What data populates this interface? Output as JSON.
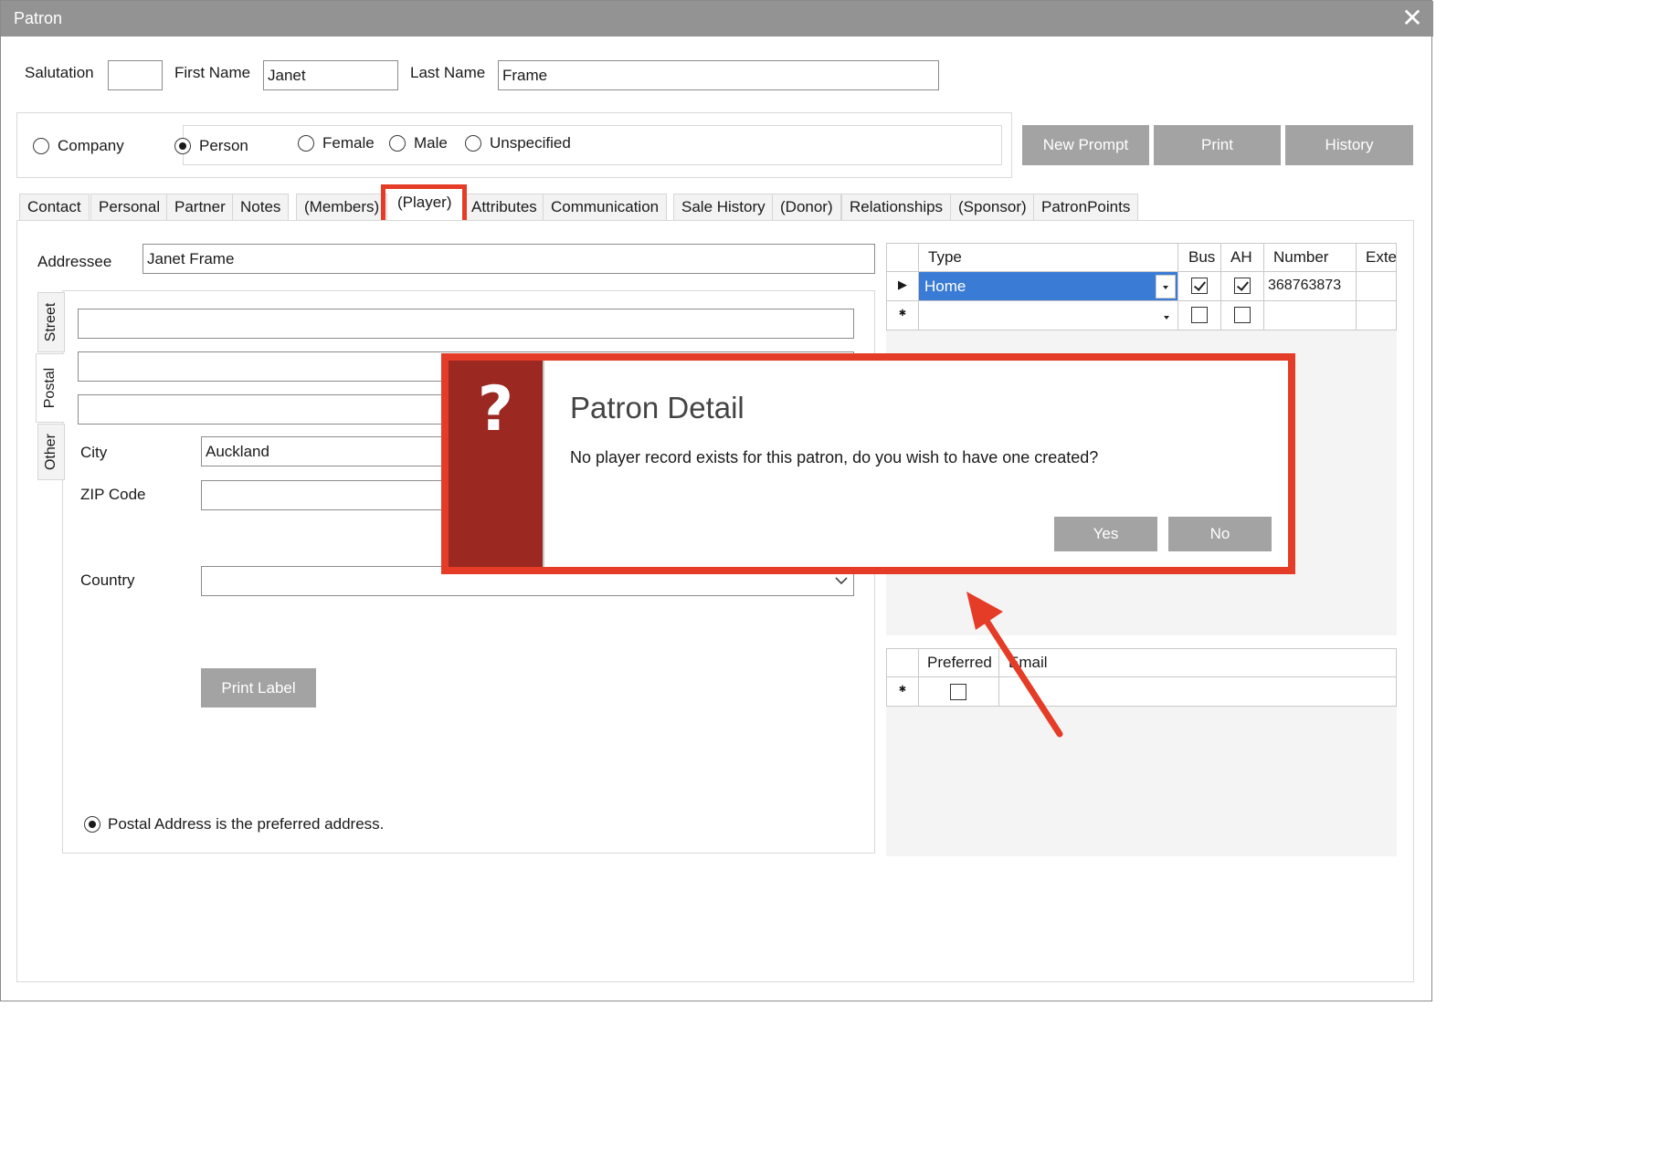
{
  "window": {
    "title": "Patron",
    "close_glyph": "✕"
  },
  "name_row": {
    "salutation_label": "Salutation",
    "salutation_value": "",
    "first_name_label": "First Name",
    "first_name_value": "Janet",
    "last_name_label": "Last Name",
    "last_name_value": "Frame"
  },
  "type_options": {
    "company": "Company",
    "person": "Person",
    "female": "Female",
    "male": "Male",
    "unspecified": "Unspecified",
    "selected": "Person"
  },
  "actions": {
    "new_prompt": "New Prompt",
    "print": "Print",
    "history": "History"
  },
  "tabs": [
    "Contact",
    "Personal",
    "Partner",
    "Notes",
    "(Members)",
    "(Player)",
    "Attributes",
    "Communication",
    "Sale History",
    "(Donor)",
    "Relationships",
    "(Sponsor)",
    "PatronPoints"
  ],
  "highlighted_tab": "(Player)",
  "address": {
    "addressee_label": "Addressee",
    "addressee_value": "Janet Frame",
    "vertical_tabs": [
      "Street",
      "Postal",
      "Other"
    ],
    "lines": [
      "",
      "",
      ""
    ],
    "city_label": "City",
    "city_value": "Auckland",
    "zip_label": "ZIP Code",
    "zip_value": "",
    "country_label": "Country",
    "country_value": "",
    "print_label_button": "Print Label",
    "preferred_text": "Postal Address is the preferred address."
  },
  "phone_grid": {
    "columns": [
      "Type",
      "Bus",
      "AH",
      "Number",
      "Exte"
    ],
    "rows": [
      {
        "marker": "▶",
        "type": "Home",
        "bus": true,
        "ah": true,
        "number": "368763873",
        "ext": ""
      },
      {
        "marker": "✱",
        "type": "",
        "bus": false,
        "ah": false,
        "number": "",
        "ext": ""
      }
    ]
  },
  "email_grid": {
    "columns": [
      "Preferred",
      "Email"
    ],
    "rows": [
      {
        "marker": "✱",
        "preferred": false,
        "email": ""
      }
    ]
  },
  "dialog": {
    "icon": "?",
    "title": "Patron Detail",
    "message": "No player record exists for this patron, do you wish to have one created?",
    "yes": "Yes",
    "no": "No"
  },
  "colors": {
    "titlebar": "#939393",
    "button_gray": "#a3a3a3",
    "highlight_red": "#e53c27",
    "dialog_side": "#9b2921",
    "selection_blue": "#3a7bd5"
  }
}
